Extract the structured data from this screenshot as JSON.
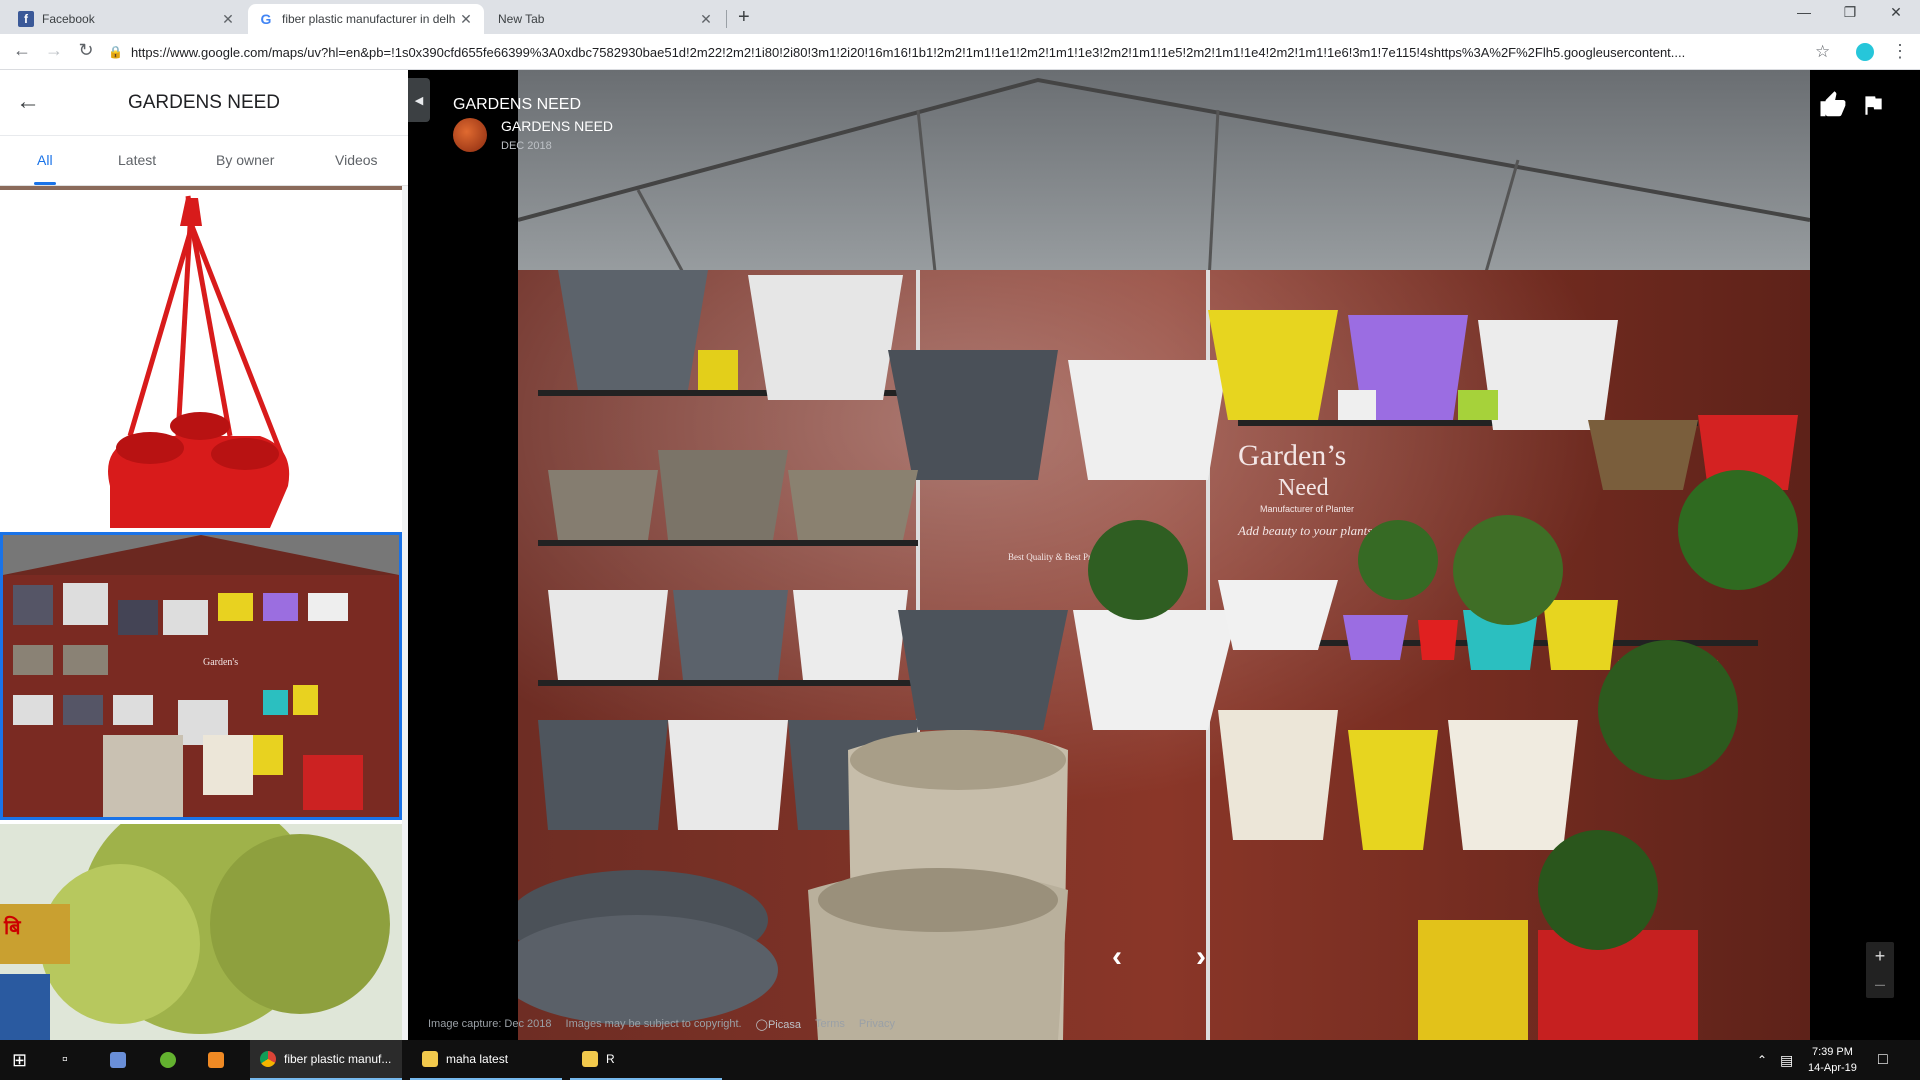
{
  "browser": {
    "tabs": [
      {
        "title": "Facebook",
        "favicon": "facebook-icon",
        "active": false
      },
      {
        "title": "fiber plastic manufacturer in delh",
        "favicon": "google-icon",
        "active": true
      },
      {
        "title": "New Tab",
        "favicon": "",
        "active": false
      }
    ],
    "url": "https://www.google.com/maps/uv?hl=en&pb=!1s0x390cfd655fe66399%3A0xdbc7582930bae51d!2m22!2m2!1i80!2i80!3m1!2i20!16m16!1b1!2m2!1m1!1e1!2m2!1m1!1e3!2m2!1m1!1e5!2m2!1m1!1e4!2m2!1m1!1e6!3m1!7e115!4shttps%3A%2F%2Flh5.googleusercontent...."
  },
  "left_panel": {
    "title": "GARDENS NEED",
    "filter_tabs": [
      "All",
      "Latest",
      "By owner",
      "Videos"
    ],
    "selected_tab": "All"
  },
  "viewer": {
    "place_title": "GARDENS NEED",
    "owner_name": "GARDENS NEED",
    "date": "DEC 2018",
    "footer": {
      "capture": "Image capture: Dec 2018",
      "copyright": "Images may be subject to copyright.",
      "picasa": "Picasa",
      "terms": "Terms",
      "privacy": "Privacy"
    },
    "photo_sign": {
      "line1": "Garden’s",
      "line2": "Need",
      "line3": "Manufacturer of Planter",
      "line4": "Add beauty to your plants",
      "line5": "Best Quality & Best Price"
    }
  },
  "taskbar": {
    "items": [
      {
        "label": "fiber plastic manuf...",
        "icon": "chrome-icon"
      },
      {
        "label": "maha latest",
        "icon": "folder-icon"
      },
      {
        "label": "R",
        "icon": "folder-icon"
      }
    ],
    "time": "7:39 PM",
    "date": "14-Apr-19"
  }
}
